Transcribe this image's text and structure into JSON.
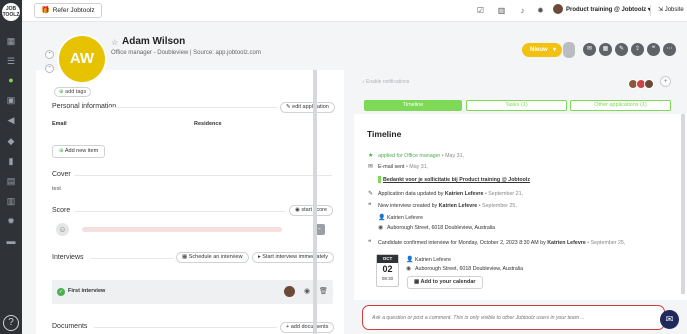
{
  "app": {
    "logo_text": "JOB TOOLZ"
  },
  "topbar": {
    "refer_label": "Refer Jobtoolz",
    "user_label": "Product training @ Jobtoolz",
    "jobsite_label": "Jobsite"
  },
  "candidate": {
    "initials": "AW",
    "name": "Adam Wilson",
    "subtitle": "Office manager - Doubleview | Source: app.jobtoolz.com",
    "stage": "Nieuw"
  },
  "left": {
    "add_tags": "add tags",
    "personal_info_title": "Personal information",
    "edit_application": "edit application",
    "email_label": "Email",
    "residence_label": "Residence",
    "add_new_item": "Add new item",
    "cover_title": "Cover",
    "cover_value": "test",
    "score_title": "Score",
    "start_score": "start score",
    "interviews_title": "Interviews",
    "schedule_interview": "Schedule an interview",
    "start_interview": "Start interview immediately",
    "first_interview": "First interview",
    "documents_title": "Documents",
    "add_documents": "add documents"
  },
  "right": {
    "enable_notifications": "Enable notifications",
    "tabs": [
      {
        "label": "Timeline"
      },
      {
        "label": "Tasks (1)"
      },
      {
        "label": "Other applications (1)"
      }
    ],
    "timeline_title": "Timeline",
    "events": {
      "applied_text": "applied for Office manager",
      "applied_date": "• May 31,",
      "email_text": "E-mail sent",
      "email_date": "• May 31,",
      "email_subject": "Bedankt voor je sollicitatie bij Product training @ Jobtoolz",
      "updated_text": "Application data updated by",
      "updated_by": "Katrien Lefevre",
      "updated_date": "• September 21,",
      "created_text": "New interview created by",
      "created_by": "Katrien Lefevre",
      "created_date": "• September 25,",
      "person1": "Katrien Lefevre",
      "address1": "Auborough Street, 6018 Doubleview, Australia",
      "confirmed_text": "Candidate confirmed interview for Monday, October 2, 2023 8:30 AM by",
      "confirmed_by": "Katrien Lefevre",
      "confirmed_date": "• September 25,",
      "person2": "Katrien Lefevre",
      "address2": "Auborough Street, 6018 Doubleview, Australia",
      "month": "OCT",
      "day": "02",
      "time": "08:30",
      "add_calendar": "Add to your calendar"
    },
    "comment_placeholder": "Ask a question or post a comment. This is only visible to other Jobtoolz users in your team ..."
  },
  "colors": {
    "accent": "#7ed957",
    "stage": "#f3c211",
    "avatar": "#e6c200",
    "highlight": "#d23c3c"
  }
}
